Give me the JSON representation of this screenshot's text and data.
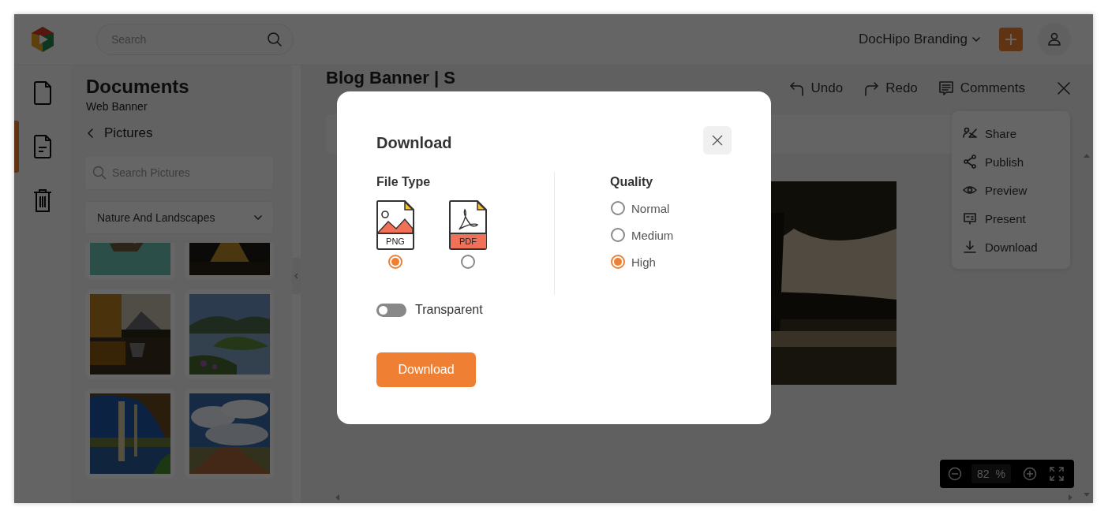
{
  "header": {
    "search": {
      "placeholder": "Search"
    },
    "brand": "DocHipo Branding"
  },
  "rail": [
    {
      "kind": "document",
      "selected": false
    },
    {
      "kind": "text-document",
      "selected": true
    },
    {
      "kind": "trash",
      "selected": false
    }
  ],
  "panel": {
    "title": "Documents",
    "subtitle": "Web Banner",
    "back": "Pictures",
    "search": {
      "placeholder": "Search Pictures"
    },
    "category": "Nature And Landscapes"
  },
  "editor": {
    "title": "Blog Banner | S",
    "actions": [
      {
        "kind": "undo",
        "label": "Undo"
      },
      {
        "kind": "redo",
        "label": "Redo"
      },
      {
        "kind": "comments",
        "label": "Comments"
      }
    ],
    "menu": [
      {
        "kind": "share",
        "label": "Share"
      },
      {
        "kind": "publish",
        "label": "Publish"
      },
      {
        "kind": "preview",
        "label": "Preview"
      },
      {
        "kind": "present",
        "label": "Present"
      },
      {
        "kind": "download",
        "label": "Download"
      }
    ],
    "zoom": {
      "value": "82",
      "unit": "%"
    }
  },
  "dialog": {
    "title": "Download",
    "file_type": {
      "label": "File Type",
      "options": [
        {
          "label": "PNG",
          "kind": "png",
          "selected": true
        },
        {
          "label": "PDF",
          "kind": "pdf",
          "selected": false
        }
      ]
    },
    "transparent": {
      "label": "Transparent",
      "on": false
    },
    "quality": {
      "label": "Quality",
      "options": [
        {
          "label": "Normal",
          "selected": false
        },
        {
          "label": "Medium",
          "selected": false
        },
        {
          "label": "High",
          "selected": true
        }
      ]
    },
    "button": "Download"
  }
}
